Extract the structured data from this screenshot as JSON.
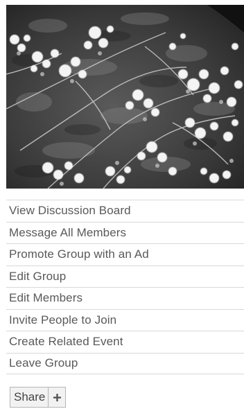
{
  "photo": {
    "icon": "group-photo-flowers"
  },
  "actions": {
    "items": [
      {
        "label": "View Discussion Board"
      },
      {
        "label": "Message All Members"
      },
      {
        "label": "Promote Group with an Ad"
      },
      {
        "label": "Edit Group"
      },
      {
        "label": "Edit Members"
      },
      {
        "label": "Invite People to Join"
      },
      {
        "label": "Create Related Event"
      },
      {
        "label": "Leave Group"
      }
    ]
  },
  "share": {
    "label": "Share",
    "plus_icon": "plus-icon"
  }
}
